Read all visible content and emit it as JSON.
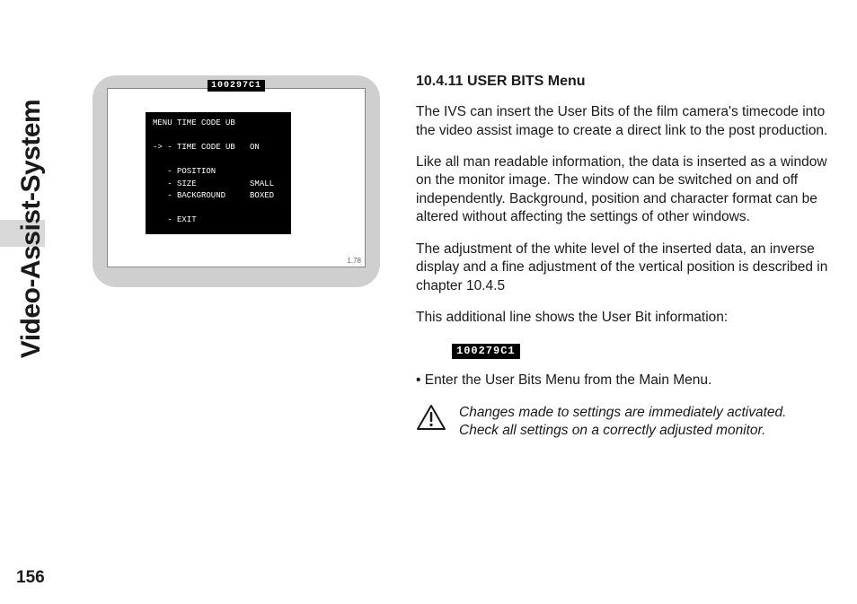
{
  "sidebar": {
    "title": "Video-Assist-System"
  },
  "page_number": "156",
  "monitor": {
    "title_code": "100297C1",
    "menu_text": "MENU TIME CODE UB\n\n-> - TIME CODE UB   ON\n\n   - POSITION\n   - SIZE           SMALL\n   - BACKGROUND     BOXED\n\n   - EXIT",
    "version": "1.78"
  },
  "content": {
    "heading": "10.4.11 USER BITS Menu",
    "p1": "The IVS can insert the User Bits of the film camera's timecode into the video assist image to create a direct link to the post production.",
    "p2": "Like all man readable information, the data is inserted as a window on the monitor image. The window can be switched on and off independently. Background, position and character format can be altered without affecting the settings of other windows.",
    "p3": "The adjustment of the white level of the inserted data, an inverse display and a fine adjustment of the vertical position is described in chapter 10.4.5",
    "p4": "This additional line shows the User Bit information:",
    "data_code": "100279C1",
    "bullet": "•  Enter the User Bits Menu from the Main Menu.",
    "note": "Changes made to settings are immediately activated. Check all settings on a correctly adjusted monitor."
  }
}
